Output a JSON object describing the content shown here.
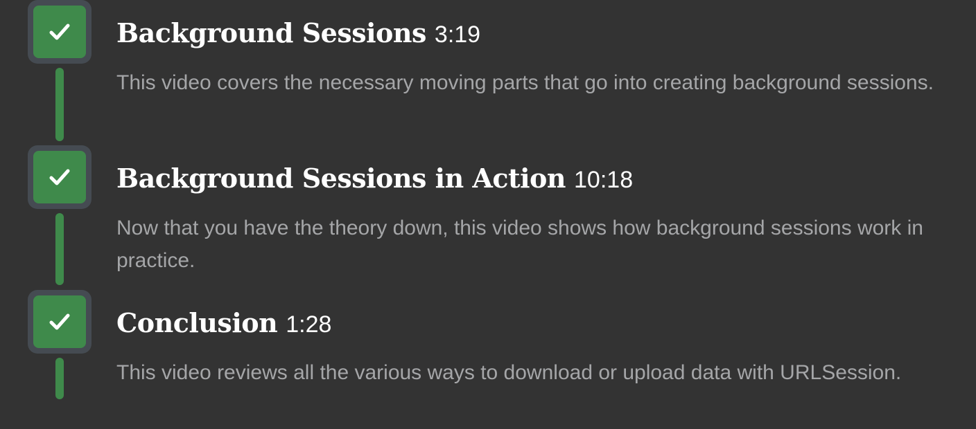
{
  "lessons": [
    {
      "title": "Background Sessions",
      "duration": "3:19",
      "description": "This video covers the necessary moving parts that go into creating background sessions.",
      "completed": true
    },
    {
      "title": "Background Sessions in Action",
      "duration": "10:18",
      "description": "Now that you have the theory down, this video shows how background sessions work in practice.",
      "completed": true
    },
    {
      "title": "Conclusion",
      "duration": "1:28",
      "description": "This video reviews all the various ways to download or upload data with URLSession.",
      "completed": true
    }
  ],
  "colors": {
    "background": "#333333",
    "accent_green": "#3f8a4b",
    "check_frame": "#454b52",
    "title": "#ffffff",
    "description": "#a5a6a8"
  },
  "icons": {
    "status": "checkmark-icon"
  }
}
